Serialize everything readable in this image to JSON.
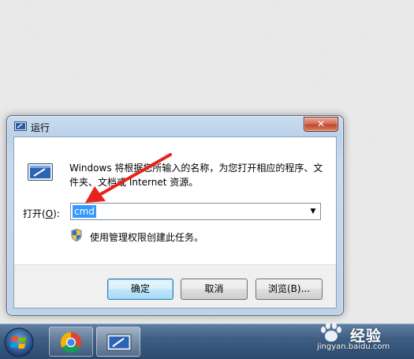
{
  "window": {
    "title": "运行",
    "close_label": "✕"
  },
  "dialog": {
    "description": "Windows 将根据您所输入的名称，为您打开相应的程序、文件夹、文档或 Internet 资源。",
    "open_label_prefix": "打开(",
    "open_label_accel": "O",
    "open_label_suffix": "):",
    "command_value": "cmd",
    "admin_note": "使用管理权限创建此任务。"
  },
  "buttons": {
    "ok": "确定",
    "cancel": "取消",
    "browse": "浏览(B)..."
  },
  "taskbar": {
    "items": [
      {
        "name": "start-orb",
        "icon": "windows-logo-icon"
      },
      {
        "name": "chrome",
        "icon": "chrome-icon"
      },
      {
        "name": "run",
        "icon": "run-icon"
      }
    ]
  },
  "watermark": {
    "brand": "经验",
    "url": "jingyan.baidu.com"
  },
  "colors": {
    "selection": "#3399ff",
    "arrow": "#e8231d",
    "close": "#c1462b",
    "taskbar": "#3f5f85"
  }
}
